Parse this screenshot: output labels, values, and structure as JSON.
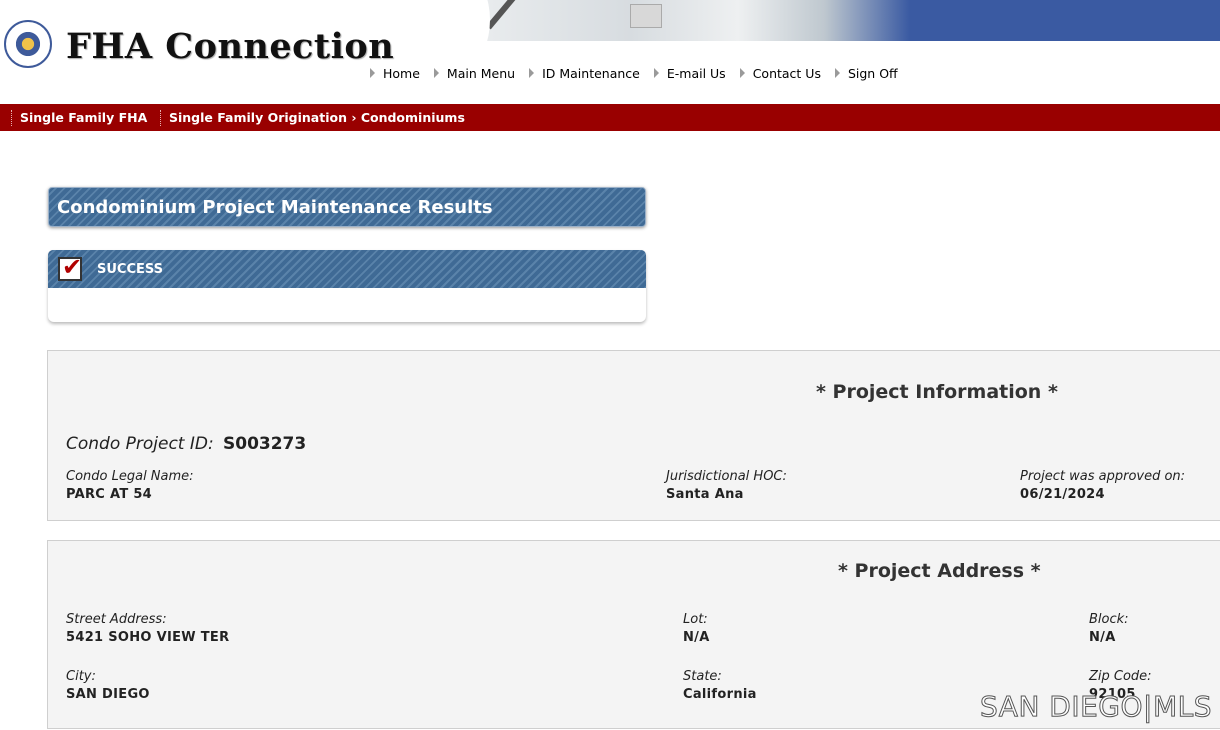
{
  "header": {
    "logo_text": "FHA Connection",
    "nav": [
      "Home",
      "Main Menu",
      "ID Maintenance",
      "E-mail Us",
      "Contact Us",
      "Sign Off"
    ]
  },
  "breadcrumb": {
    "section": "Single Family FHA",
    "path": "Single Family Origination › Condominiums"
  },
  "page_title": "Condominium Project Maintenance Results",
  "status": {
    "label": "SUCCESS"
  },
  "project_information": {
    "heading": "* Project Information *",
    "id_label": "Condo Project ID:",
    "id_value": "S003273",
    "legal_name_label": "Condo Legal Name:",
    "legal_name_value": "PARC AT 54",
    "hoc_label": "Jurisdictional HOC:",
    "hoc_value": "Santa Ana",
    "approved_label": "Project was approved on:",
    "approved_value": "06/21/2024"
  },
  "project_address": {
    "heading": "* Project Address *",
    "street_label": "Street Address:",
    "street_value": "5421 SOHO VIEW TER",
    "lot_label": "Lot:",
    "lot_value": "N/A",
    "block_label": "Block:",
    "block_value": "N/A",
    "city_label": "City:",
    "city_value": "SAN DIEGO",
    "state_label": "State:",
    "state_value": "California",
    "zip_label": "Zip Code:",
    "zip_value": "92105"
  },
  "watermark": "SAN DIEGO|MLS",
  "colors": {
    "brand_red": "#990000",
    "header_blue": "#3a5aa2",
    "panel_blue": "#3f6a95"
  }
}
